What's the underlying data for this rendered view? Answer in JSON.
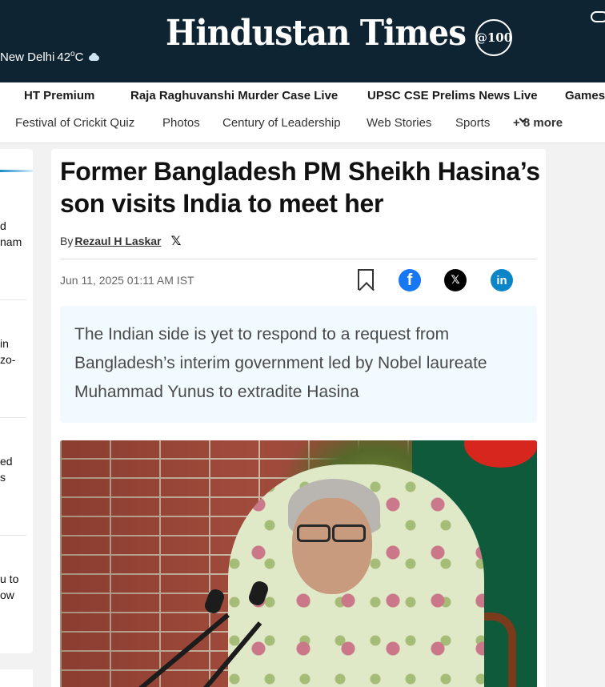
{
  "header": {
    "brand": "Hindustan Times",
    "badge": "@100",
    "weather": {
      "city": "New Delhi",
      "temp": "42",
      "unit": "C",
      "icon": "cloud-icon"
    }
  },
  "nav": {
    "row1": [
      "HT Premium",
      "Raja Raghuvanshi Murder Case Live",
      "UPSC CSE Prelims News Live",
      "Games"
    ],
    "row2": [
      "Festival of Crickit Quiz",
      "Photos",
      "Century of Leadership",
      "Web Stories",
      "Sports"
    ],
    "more": "+ 8 more"
  },
  "sidebar": {
    "items": [
      [
        "d",
        "nam"
      ],
      [
        "in",
        "zo-"
      ],
      [
        "ed",
        "s"
      ],
      [
        "u to",
        "ow"
      ]
    ]
  },
  "article": {
    "headline": "Former Bangladesh PM Sheikh Hasina’s son visits India to meet her",
    "by": "By",
    "author": "Rezaul H Laskar",
    "date": "Jun 11, 2025 01:11 AM IST",
    "summary": "The Indian side is yet to respond to a request from Bangladesh’s interim government led by Nobel laureate Muhammad Yunus to extradite Hasina",
    "share": {
      "facebook": "f",
      "x": "𝕏",
      "linkedin": "in"
    }
  },
  "colors": {
    "header_bg": "#0f2433",
    "facebook": "#1877f2",
    "linkedin": "#0a85c8",
    "summary_bg": "#f1fafe"
  }
}
